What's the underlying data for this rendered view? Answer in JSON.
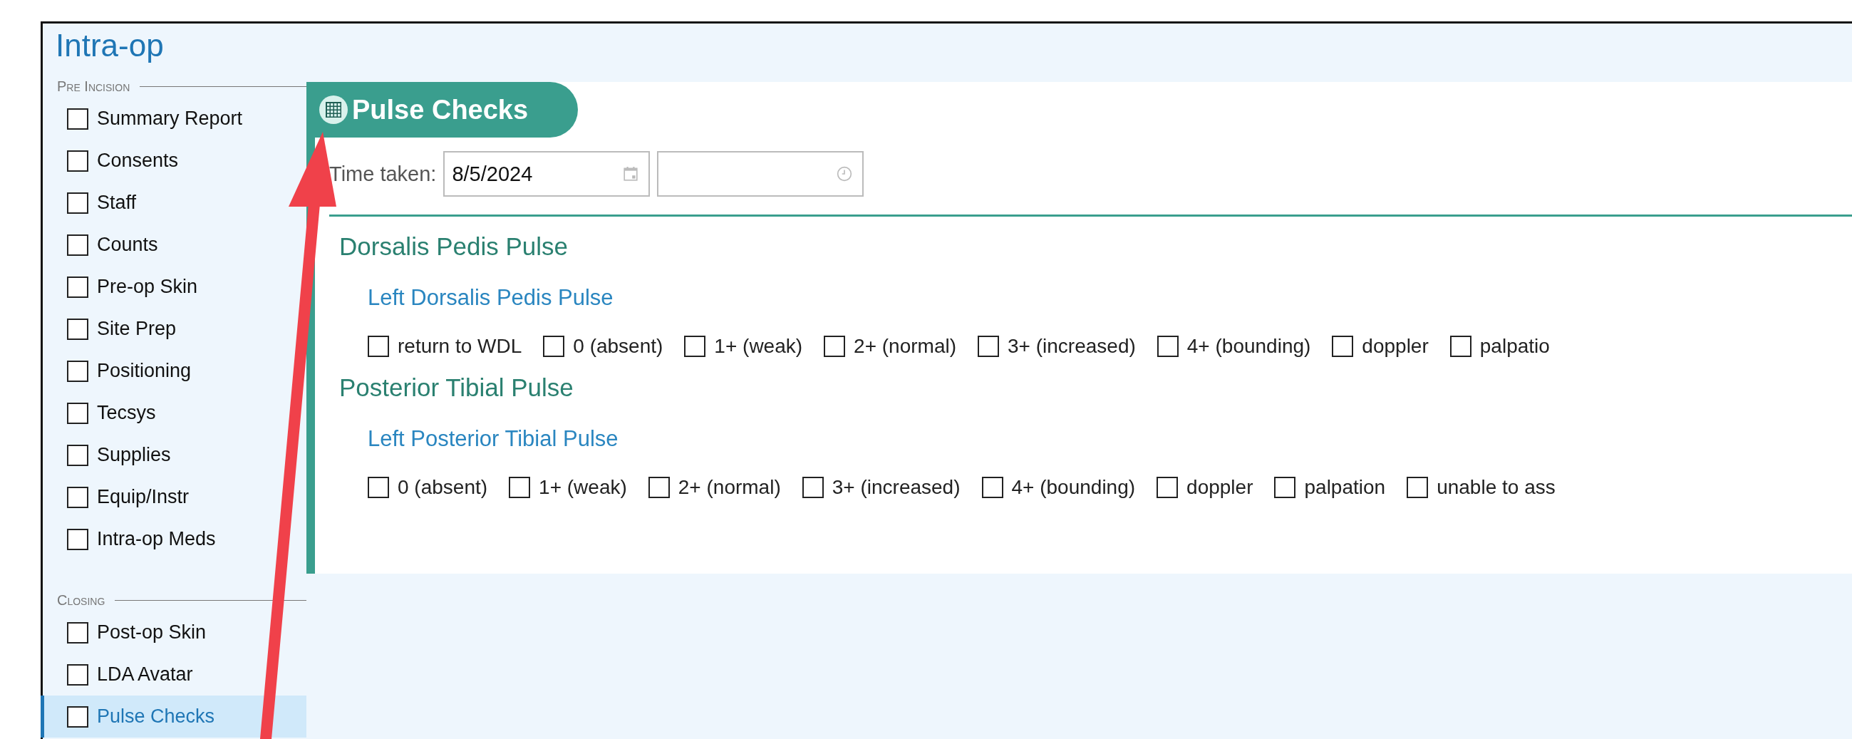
{
  "title": "Intra-op",
  "sidebar": {
    "sections": [
      {
        "heading": "Pre Incision",
        "items": [
          {
            "label": "Summary Report",
            "checked": false,
            "selected": false
          },
          {
            "label": "Consents",
            "checked": false,
            "selected": false
          },
          {
            "label": "Staff",
            "checked": false,
            "selected": false
          },
          {
            "label": "Counts",
            "checked": false,
            "selected": false
          },
          {
            "label": "Pre-op Skin",
            "checked": false,
            "selected": false
          },
          {
            "label": "Site Prep",
            "checked": false,
            "selected": false
          },
          {
            "label": "Positioning",
            "checked": false,
            "selected": false
          },
          {
            "label": "Tecsys",
            "checked": false,
            "selected": false
          },
          {
            "label": "Supplies",
            "checked": false,
            "selected": false
          },
          {
            "label": "Equip/Instr",
            "checked": false,
            "selected": false
          },
          {
            "label": "Intra-op Meds",
            "checked": false,
            "selected": false
          }
        ]
      },
      {
        "heading": "Closing",
        "items": [
          {
            "label": "Post-op Skin",
            "checked": false,
            "selected": false
          },
          {
            "label": "LDA Avatar",
            "checked": false,
            "selected": false
          },
          {
            "label": "Pulse Checks",
            "checked": false,
            "selected": true
          }
        ]
      }
    ]
  },
  "panel": {
    "title": "Pulse Checks",
    "time_taken": {
      "label": "Time taken:",
      "date": "8/5/2024"
    },
    "groups": [
      {
        "heading": "Dorsalis Pedis Pulse",
        "subheading": "Left Dorsalis Pedis Pulse",
        "options": [
          {
            "label": "return to WDL",
            "checked": false
          },
          {
            "label": "0 (absent)",
            "checked": false
          },
          {
            "label": "1+ (weak)",
            "checked": false
          },
          {
            "label": "2+ (normal)",
            "checked": false
          },
          {
            "label": "3+ (increased)",
            "checked": false
          },
          {
            "label": "4+ (bounding)",
            "checked": false
          },
          {
            "label": "doppler",
            "checked": false
          },
          {
            "label": "palpatio",
            "checked": false
          }
        ]
      },
      {
        "heading": "Posterior Tibial Pulse",
        "subheading": "Left Posterior Tibial Pulse",
        "options": [
          {
            "label": "0 (absent)",
            "checked": false
          },
          {
            "label": "1+ (weak)",
            "checked": false
          },
          {
            "label": "2+ (normal)",
            "checked": false
          },
          {
            "label": "3+ (increased)",
            "checked": false
          },
          {
            "label": "4+ (bounding)",
            "checked": false
          },
          {
            "label": "doppler",
            "checked": false
          },
          {
            "label": "palpation",
            "checked": false
          },
          {
            "label": "unable to ass",
            "checked": false
          }
        ]
      }
    ]
  }
}
